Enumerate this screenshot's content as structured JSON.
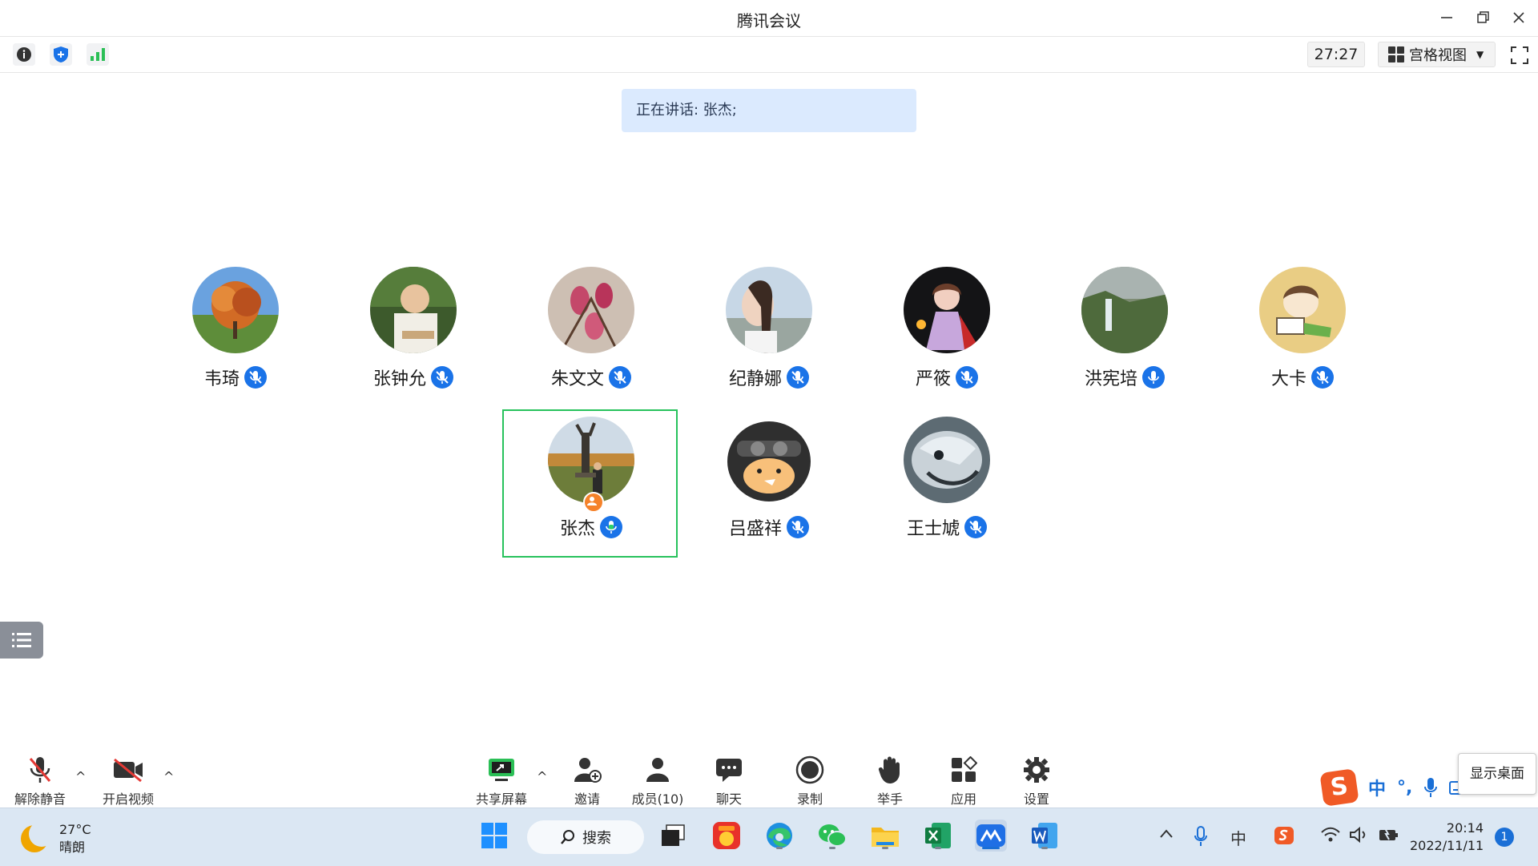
{
  "window": {
    "title": "腾讯会议",
    "controls": [
      "minimize-icon",
      "restore-icon",
      "close-icon"
    ]
  },
  "topbar": {
    "timer": "27:27",
    "view_mode": "宫格视图",
    "left_icons": [
      "info-icon",
      "shield-icon",
      "signal-icon"
    ]
  },
  "speaking": "正在讲话: 张杰;",
  "participants": [
    {
      "name": "韦琦",
      "mic": "muted"
    },
    {
      "name": "张钟允",
      "mic": "muted"
    },
    {
      "name": "朱文文",
      "mic": "muted"
    },
    {
      "name": "纪静娜",
      "mic": "muted"
    },
    {
      "name": "严筱",
      "mic": "muted"
    },
    {
      "name": "洪宪培",
      "mic": "on"
    },
    {
      "name": "大卡",
      "mic": "muted"
    },
    {
      "name": "张杰",
      "mic": "speaking",
      "host": true,
      "active": true
    },
    {
      "name": "吕盛祥",
      "mic": "muted"
    },
    {
      "name": "王士虓",
      "mic": "muted"
    }
  ],
  "meeting_bar": {
    "unmute": "解除静音",
    "start_video": "开启视频",
    "share_screen": "共享屏幕",
    "invite": "邀请",
    "members": "成员(10)",
    "chat": "聊天",
    "record": "录制",
    "raise_hand": "举手",
    "apps": "应用",
    "settings": "设置"
  },
  "show_desktop": "显示桌面",
  "ime": {
    "lang": "中"
  },
  "taskbar": {
    "weather_temp": "27°C",
    "weather_desc": "晴朗",
    "search": "搜索",
    "tray_lang": "中",
    "time": "20:14",
    "date": "2022/11/11",
    "notifications": "1"
  },
  "colors": {
    "accent": "#1a73e8",
    "active_speaker_frame": "#27c25c",
    "speaking_banner": "#dbeafe",
    "taskbar": "#dbe7f3"
  }
}
